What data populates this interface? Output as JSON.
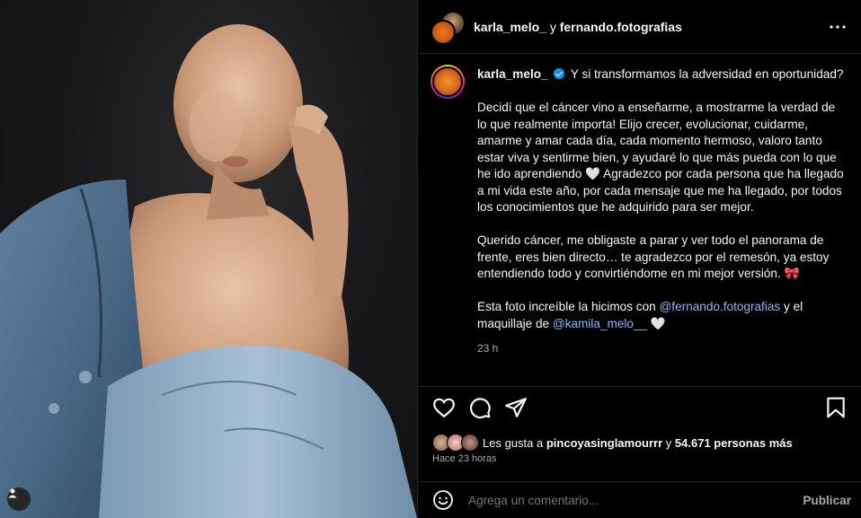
{
  "header": {
    "user1": "karla_melo_",
    "joiner": "y",
    "user2": "fernando.fotografias"
  },
  "caption": {
    "username": "karla_melo_",
    "line1": "Y si transformamos la adversidad en oportunidad?",
    "para2": "Decidí que el cáncer vino a enseñarme, a mostrarme la verdad de lo que realmente importa! Elijo crecer, evolucionar, cuidarme, amarme y amar cada día, cada momento hermoso, valoro tanto estar viva y sentirme bien, y ayudaré lo que más pueda con lo que he ido aprendiendo 🤍 Agradezco por cada persona que ha llegado a mi vida este año, por cada mensaje que me ha llegado, por todos los conocimientos que he adquirido para ser mejor.",
    "para3": "Querido cáncer, me obligaste a parar y ver todo el panorama de frente, eres bien directo… te agradezco por el remesón, ya estoy entendiendo todo y convirtiéndome en mi mejor versión. 🎀",
    "para4_start": "Esta foto increíble la hicimos con",
    "mention1": "@fernando.fotografias",
    "para4_mid": "y el maquillaje de",
    "mention2": "@kamila_melo__",
    "para4_end": "🤍",
    "time": "23 h"
  },
  "icons": {
    "like": "heart-icon",
    "comment": "comment-icon",
    "share": "share-icon",
    "save": "bookmark-icon",
    "more": "more-icon",
    "tagged": "user-tag-icon",
    "emoji": "emoji-icon"
  },
  "likes": {
    "prefix": "Les gusta a",
    "user": "pincoyasinglamourrr",
    "joiner": "y",
    "count": "54.671 personas más"
  },
  "ago": "Hace 23 horas",
  "comment_box": {
    "placeholder": "Agrega un comentario...",
    "post_label": "Publicar"
  },
  "colors": {
    "mention": "#8ab4f8",
    "verified": "#0095f6",
    "muted": "#a8a8a8"
  }
}
